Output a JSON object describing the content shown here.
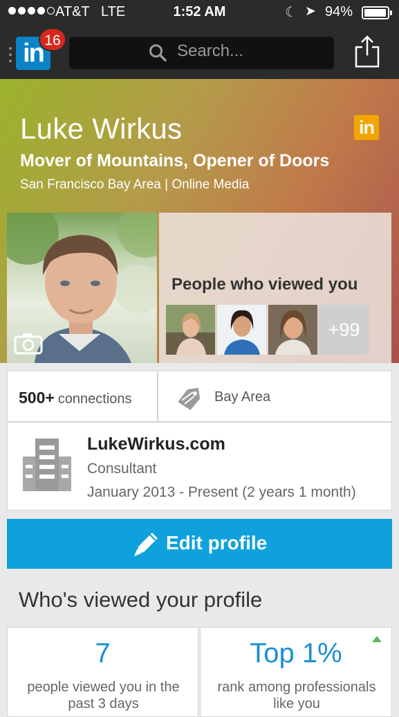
{
  "status_bar": {
    "carrier": "AT&T",
    "network": "LTE",
    "time": "1:52 AM",
    "battery": "94%"
  },
  "nav": {
    "logo": "in",
    "notification_count": "16",
    "search_placeholder": "Search..."
  },
  "profile": {
    "name": "Luke Wirkus",
    "headline": "Mover of Mountains, Opener of Doors",
    "location_industry": "San Francisco Bay Area | Online Media",
    "linkedin_badge": "in"
  },
  "viewers": {
    "title": "People who viewed you",
    "more_count": "+99"
  },
  "connections": {
    "count": "500+",
    "label": "connections"
  },
  "region": "Bay Area",
  "position": {
    "company": "LukeWirkus.com",
    "title": "Consultant",
    "dates": "January 2013 - Present (2 years 1 month)"
  },
  "edit_profile_label": "Edit profile",
  "whos_viewed": {
    "title": "Who's viewed your profile",
    "stats": [
      {
        "value": "7",
        "label": "people viewed you in the past 3 days"
      },
      {
        "value": "Top 1%",
        "label": "rank among professionals like you"
      }
    ]
  },
  "colors": {
    "brand_blue": "#0a84c6",
    "edit_button": "#0ea1dc",
    "stat_blue": "#1a8fd5",
    "badge_red": "#d7281e",
    "trend_green": "#5cb85c"
  },
  "icons": [
    "search-icon",
    "share-icon",
    "camera-icon",
    "tag-icon",
    "building-icon",
    "pencil-icon",
    "trend-up-icon"
  ]
}
